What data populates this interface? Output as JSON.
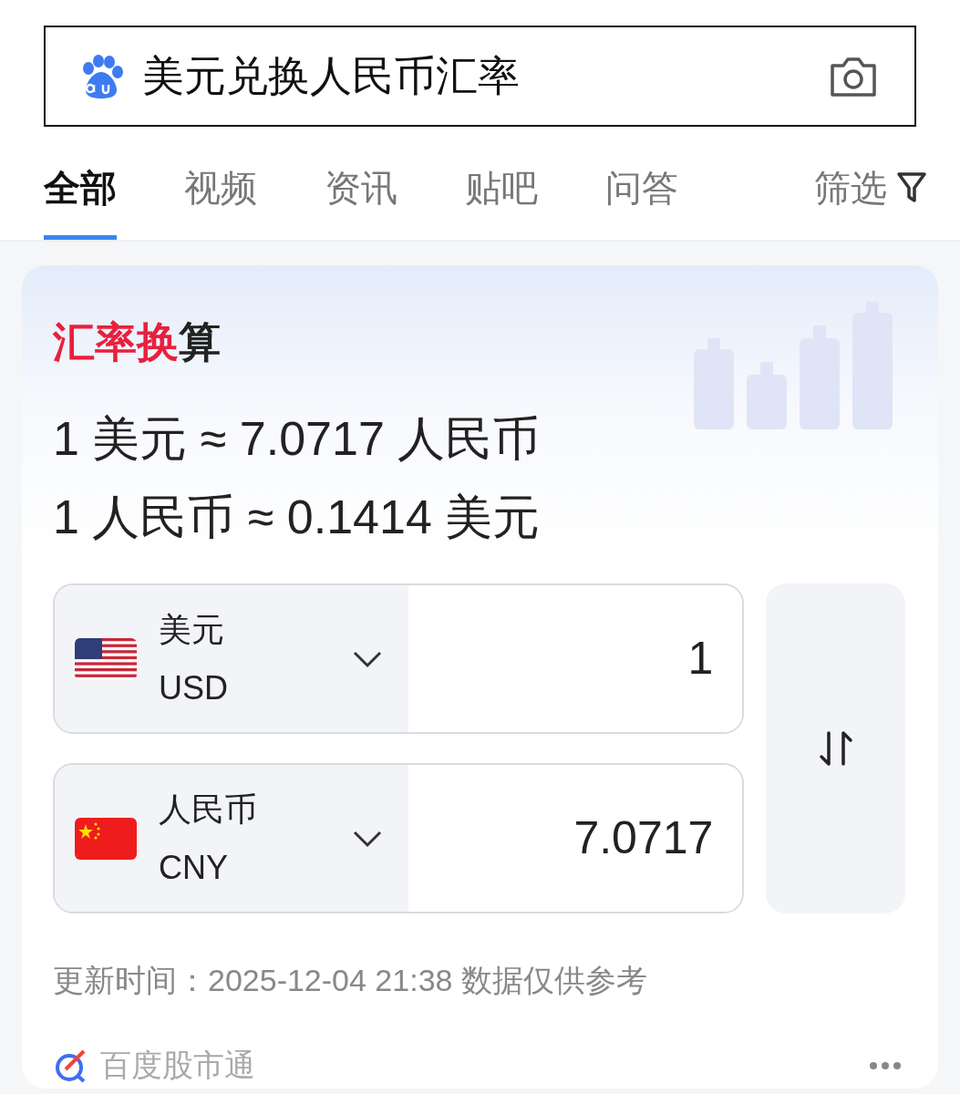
{
  "search": {
    "value": "美元兑换人民币汇率"
  },
  "tabs": [
    {
      "label": "全部",
      "selected": true
    },
    {
      "label": "视频",
      "selected": false
    },
    {
      "label": "资讯",
      "selected": false
    },
    {
      "label": "贴吧",
      "selected": false
    },
    {
      "label": "问答",
      "selected": false
    }
  ],
  "filter": {
    "label": "筛选"
  },
  "card": {
    "title": {
      "highlight": "汇率换",
      "rest": "算"
    },
    "rates": [
      "1 美元 ≈ 7.0717 人民币",
      "1 人民币 ≈ 0.1414 美元"
    ],
    "currencies": [
      {
        "kind": "us",
        "name": "美元",
        "code": "USD",
        "amount": "1"
      },
      {
        "kind": "cn",
        "name": "人民币",
        "code": "CNY",
        "amount": "7.0717"
      }
    ],
    "updated": "更新时间：2025-12-04 21:38 数据仅供参考",
    "source": "百度股市通"
  }
}
